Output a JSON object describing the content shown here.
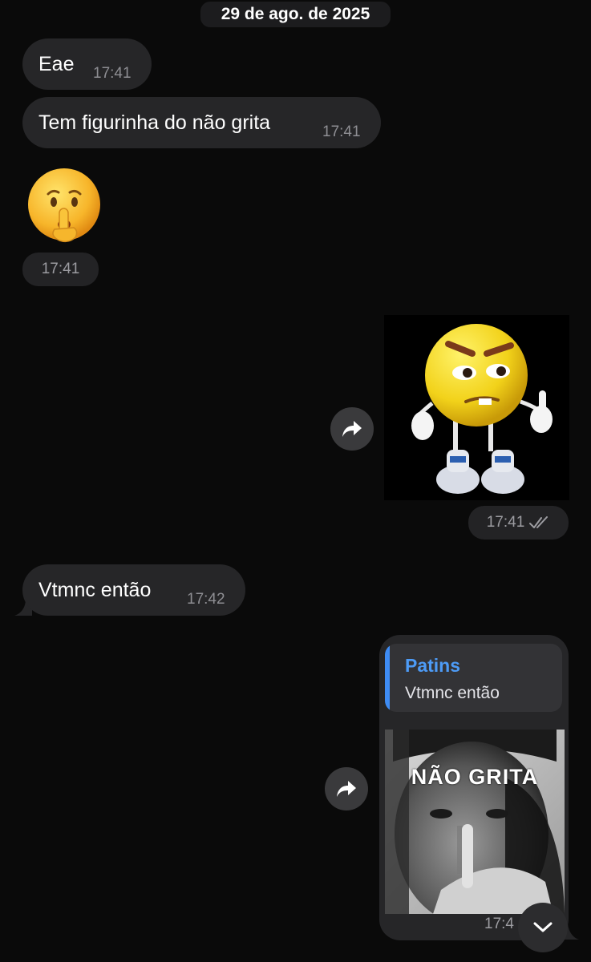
{
  "date_header": "29 de ago. de 2025",
  "messages": [
    {
      "text": "Eae",
      "time": "17:41"
    },
    {
      "text": "Tem figurinha do não grita",
      "time": "17:41"
    },
    {
      "emoji": "🤫",
      "time": "17:41"
    },
    {
      "sticker": "angry-emoji-sticker",
      "time": "17:41",
      "status": "read-double-check-icon"
    },
    {
      "text": "Vtmnc então",
      "time": "17:42"
    },
    {
      "reply": {
        "name": "Patins",
        "text": "Vtmnc então"
      },
      "image_caption": "NÃO GRITA",
      "time": "17:4"
    }
  ],
  "colors": {
    "background": "#0a0a0a",
    "bubble": "#262628",
    "accent": "#4d9bf6"
  }
}
